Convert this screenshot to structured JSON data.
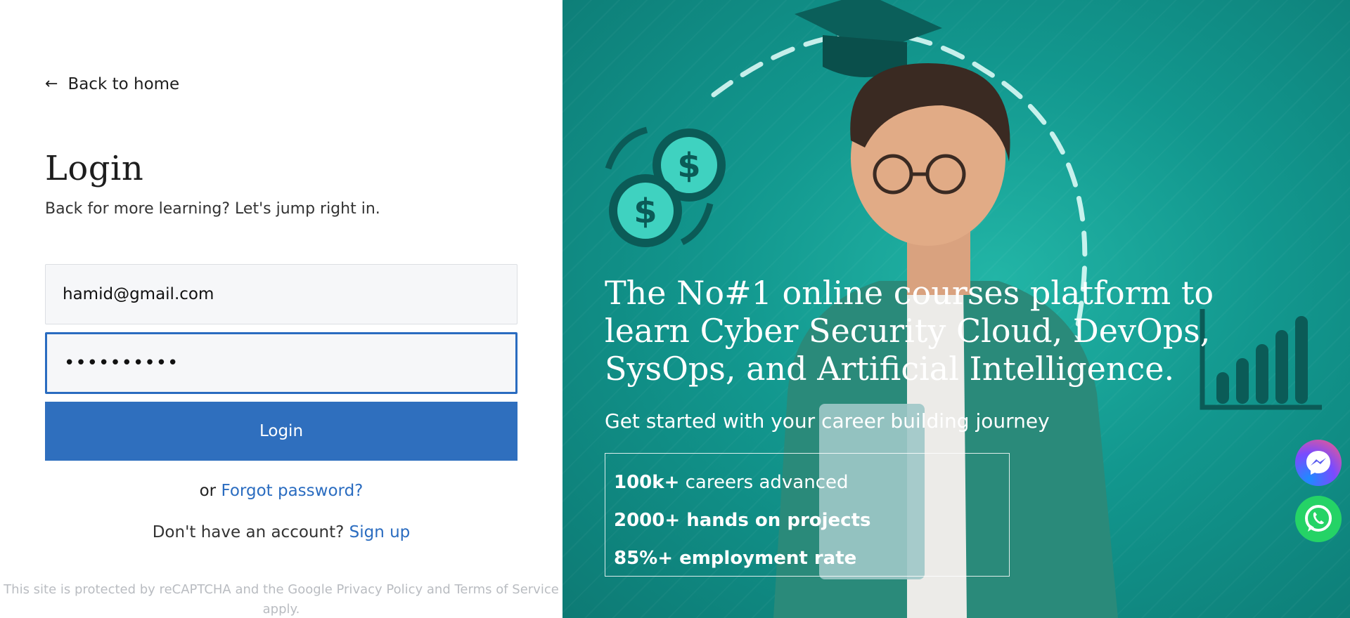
{
  "nav": {
    "back_label": "Back to home",
    "back_icon": "arrow-left-icon"
  },
  "form": {
    "title": "Login",
    "subtitle": "Back for more learning? Let's jump right in.",
    "email_value": "hamid@gmail.com",
    "password_masked": "••••••••••",
    "login_label": "Login",
    "or_text": "or",
    "forgot_label": "Forgot password?",
    "no_account_text": "Don't have an account?",
    "signup_label": "Sign up",
    "recaptcha_text": "This site is protected by reCAPTCHA and the Google Privacy Policy and Terms of Service apply."
  },
  "hero": {
    "headline": "The No#1 online courses platform to learn Cyber Security Cloud, DevOps, SysOps, and Artificial Intelligence.",
    "subline": "Get started with your career building journey",
    "stats": [
      {
        "strong": "100k+",
        "rest": " careers advanced"
      },
      {
        "strong": "2000+ hands on projects",
        "rest": ""
      },
      {
        "strong": "85%+ employment rate",
        "rest": ""
      }
    ]
  },
  "floating": {
    "messenger_icon": "messenger-icon",
    "whatsapp_icon": "whatsapp-icon"
  },
  "colors": {
    "primary": "#2f6fbe",
    "link": "#2a6cc0",
    "hero_bg": "#12978e"
  }
}
